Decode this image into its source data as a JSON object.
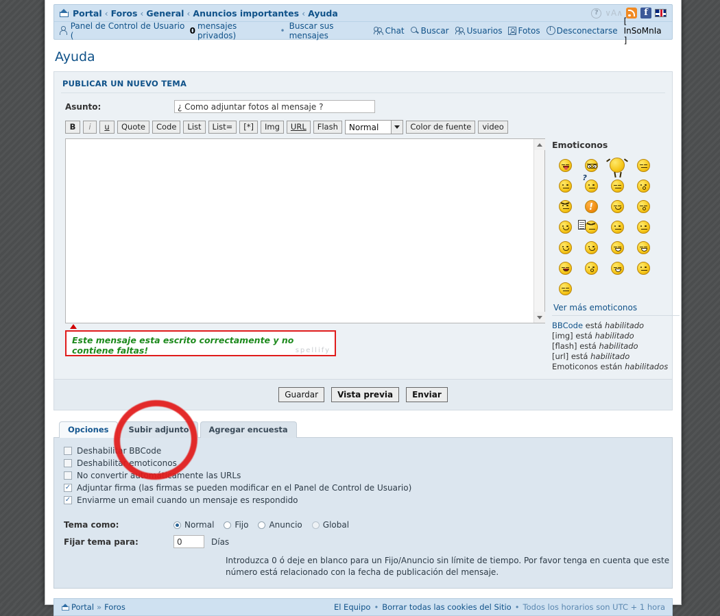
{
  "breadcrumb": {
    "home_icon": "home-icon",
    "items": [
      "Portal",
      "Foros",
      "General",
      "Anuncios importantes",
      "Ayuda"
    ],
    "separator": "‹"
  },
  "header_icons": [
    {
      "name": "help-icon",
      "glyph": "?"
    },
    {
      "name": "font-size-icon",
      "glyph": "∨A∧"
    },
    {
      "name": "rss-icon",
      "glyph": ""
    },
    {
      "name": "facebook-icon",
      "glyph": "f"
    },
    {
      "name": "language-flag-icon",
      "glyph": ""
    }
  ],
  "userbar": {
    "ucp_label": "Panel de Control de Usuario (",
    "pm_count": "0",
    "pm_label": " mensajes privados)",
    "dot": "•",
    "search_own": "Buscar sus mensajes",
    "links": [
      {
        "name": "chat-link",
        "label": "Chat",
        "icon": "people-icon"
      },
      {
        "name": "search-link",
        "label": "Buscar",
        "icon": "search-icon"
      },
      {
        "name": "members-link",
        "label": "Usuarios",
        "icon": "people-icon"
      },
      {
        "name": "photos-link",
        "label": "Fotos",
        "icon": "photo-icon"
      },
      {
        "name": "logout-link",
        "label": "Desconectarse",
        "icon": "power-icon"
      }
    ],
    "username_bracket": "[ InSoMnIa ]"
  },
  "page_title": "Ayuda",
  "form": {
    "panel_title": "PUBLICAR UN NUEVO TEMA",
    "subject_label": "Asunto:",
    "subject_value": "¿ Como adjuntar fotos al mensaje ?",
    "message_value": ""
  },
  "bbcode_toolbar": {
    "buttons": [
      {
        "name": "bold-button",
        "label": "B"
      },
      {
        "name": "italic-button",
        "label": "i"
      },
      {
        "name": "underline-button",
        "label": "u"
      },
      {
        "name": "quote-button",
        "label": "Quote"
      },
      {
        "name": "code-button",
        "label": "Code"
      },
      {
        "name": "list-button",
        "label": "List"
      },
      {
        "name": "list-ordered-button",
        "label": "List="
      },
      {
        "name": "list-item-button",
        "label": "[*]"
      },
      {
        "name": "image-button",
        "label": "Img"
      },
      {
        "name": "url-button",
        "label": "URL"
      },
      {
        "name": "flash-button",
        "label": "Flash"
      }
    ],
    "font_size_value": "Normal",
    "font_color_label": "Color de fuente",
    "video_label": "video"
  },
  "spellcheck": {
    "message": "Este mensaje esta escrito correctamente y no contiene faltas!",
    "watermark": "spellify"
  },
  "emoticons": {
    "title": "Emoticonos",
    "more_label": "Ver más emoticonos",
    "rows": [
      [
        {
          "name": "emoticon-tongue",
          "type": "tongue"
        },
        {
          "name": "emoticon-cool",
          "type": "glasses"
        },
        {
          "name": "emoticon-dance",
          "type": "dance"
        },
        {
          "name": "emoticon-sleepy",
          "type": "closed"
        },
        {
          "name": "emoticon-rolleyes",
          "type": "rolleyes"
        }
      ],
      [
        {
          "name": "emoticon-question",
          "type": "question"
        },
        {
          "name": "emoticon-smirk",
          "type": "smirk"
        },
        {
          "name": "emoticon-surprised",
          "type": "surprised"
        },
        {
          "name": "emoticon-angry",
          "type": "angry"
        },
        {
          "name": "emoticon-exclamation",
          "type": "exclaim"
        }
      ],
      [
        {
          "name": "emoticon-happy",
          "type": "happy"
        },
        {
          "name": "emoticon-kiss",
          "type": "kiss"
        },
        {
          "name": "emoticon-wave",
          "type": "wave"
        },
        {
          "name": "emoticon-writing",
          "type": "note"
        }
      ],
      [
        {
          "name": "emoticon-sleeping",
          "type": "sleep"
        },
        {
          "name": "emoticon-dizzy",
          "type": "dizzy"
        },
        {
          "name": "emoticon-crosseyed",
          "type": "cross"
        },
        {
          "name": "emoticon-smile",
          "type": "smile"
        },
        {
          "name": "emoticon-grin",
          "type": "grin"
        }
      ],
      [
        {
          "name": "emoticon-biggrin",
          "type": "teeth"
        },
        {
          "name": "emoticon-laugh",
          "type": "laugh"
        },
        {
          "name": "emoticon-shocked",
          "type": "shock"
        },
        {
          "name": "emoticon-thumbsup",
          "type": "thumb"
        }
      ],
      [
        {
          "name": "emoticon-think",
          "type": "think"
        },
        {
          "name": "emoticon-neutral",
          "type": "neutral"
        }
      ]
    ]
  },
  "bbinfo": {
    "lines": [
      {
        "code": "BBCode",
        "mid": " está ",
        "state": "habilitado"
      },
      {
        "code": "[img]",
        "mid": " está ",
        "state": "habilitado"
      },
      {
        "code": "[flash]",
        "mid": " está ",
        "state": "habilitado"
      },
      {
        "code": "[url]",
        "mid": " está ",
        "state": "habilitado"
      },
      {
        "code": "Emoticonos",
        "mid": " están ",
        "state": "habilitados"
      }
    ]
  },
  "submit_buttons": [
    {
      "name": "save-button",
      "label": "Guardar"
    },
    {
      "name": "preview-button",
      "label": "Vista previa"
    },
    {
      "name": "submit-button",
      "label": "Enviar"
    }
  ],
  "tabs": [
    {
      "name": "tab-opciones",
      "label": "Opciones",
      "active": true
    },
    {
      "name": "tab-subir-adjunto",
      "label": "Subir adjunto",
      "active": false
    },
    {
      "name": "tab-agregar-encuesta",
      "label": "Agregar encuesta",
      "active": false
    }
  ],
  "options": [
    {
      "name": "checkbox-disable-bbcode",
      "label": "Deshabilitar BBCode",
      "checked": false
    },
    {
      "name": "checkbox-disable-smilies",
      "label": "Deshabilitar emoticonos",
      "checked": false
    },
    {
      "name": "checkbox-no-auto-urls",
      "label": "No convertir automáticamente las URLs",
      "checked": false
    },
    {
      "name": "checkbox-attach-signature",
      "label": "Adjuntar firma (las firmas se pueden modificar en el Panel de Control de Usuario)",
      "checked": true
    },
    {
      "name": "checkbox-notify-reply",
      "label": "Enviarme un email cuando un mensaje es respondido",
      "checked": true
    }
  ],
  "topic_type": {
    "label": "Tema como:",
    "options": [
      {
        "name": "radio-normal",
        "label": "Normal",
        "selected": true,
        "dim": false
      },
      {
        "name": "radio-fijo",
        "label": "Fijo",
        "selected": false,
        "dim": false
      },
      {
        "name": "radio-anuncio",
        "label": "Anuncio",
        "selected": false,
        "dim": false
      },
      {
        "name": "radio-global",
        "label": "Global",
        "selected": false,
        "dim": true
      }
    ]
  },
  "stick_topic": {
    "label": "Fijar tema para:",
    "value": "0",
    "unit": "Días",
    "hint": "Introduzca 0 ó deje en blanco para un Fijo/Anuncio sin límite de tiempo. Por favor tenga en cuenta que este número está relacionado con la fecha de publicación del mensaje."
  },
  "footer": {
    "left": [
      "Portal",
      "Foros"
    ],
    "left_sep": "»",
    "team": "El Equipo",
    "dot": "•",
    "cookies": "Borrar todas las cookies del Sitio",
    "timezone": "Todos los horarios son UTC + 1 hora"
  },
  "colors": {
    "accent": "#105289",
    "nav_bg": "#cfe1f1",
    "panel_bg": "#ecf1f5",
    "options_bg": "#dce6ef",
    "annotation": "#e21b1b",
    "spell_ok": "#1d8a1d"
  }
}
